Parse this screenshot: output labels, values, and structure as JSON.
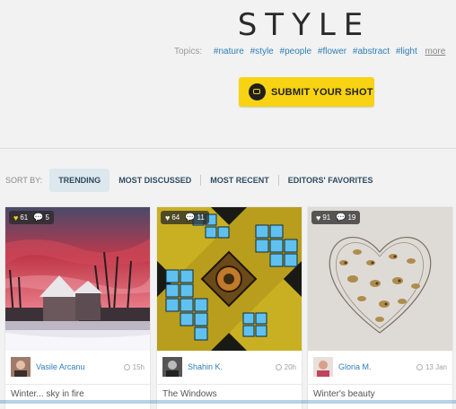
{
  "header": {
    "title": "STYLE"
  },
  "topics": {
    "label": "Topics:",
    "tags": [
      "#nature",
      "#style",
      "#people",
      "#flower",
      "#abstract",
      "#light"
    ],
    "more_label": "more"
  },
  "submit": {
    "label": "SUBMIT YOUR SHOT",
    "color": "#f7d313",
    "icon": "camera-icon"
  },
  "sort": {
    "label": "SORT BY:",
    "tabs": [
      "TRENDING",
      "MOST DISCUSSED",
      "MOST RECENT",
      "EDITORS' FAVORITES"
    ],
    "active": "TRENDING"
  },
  "cards": [
    {
      "likes": "61",
      "comments": "5",
      "author": "Vasile Arcanu",
      "time": "15h",
      "title": "Winter... sky in fire"
    },
    {
      "likes": "64",
      "comments": "11",
      "author": "Shahin K.",
      "time": "20h",
      "title": "The Windows"
    },
    {
      "likes": "91",
      "comments": "19",
      "author": "Gloria M.",
      "time": "13 Jan",
      "title": "Winter's beauty"
    }
  ],
  "colors": {
    "link": "#2f7fb8",
    "accent": "#f7d313"
  }
}
